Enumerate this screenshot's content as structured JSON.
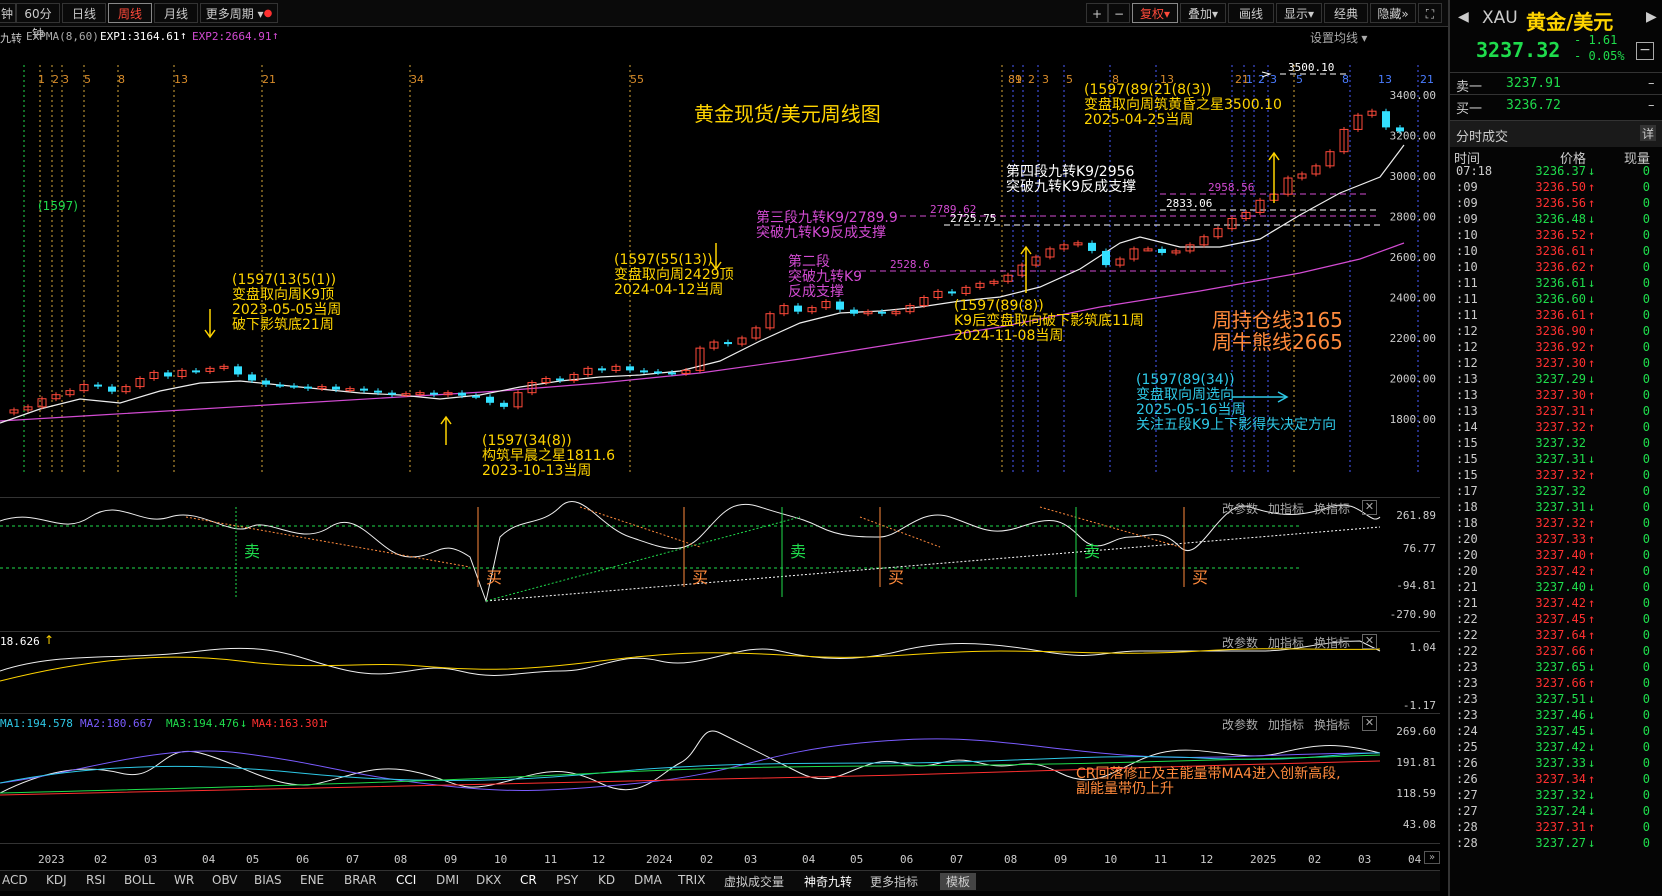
{
  "toolbar": {
    "left_tabs": [
      "钟",
      "60分钟",
      "日线",
      "周线",
      "月线",
      "更多周期"
    ],
    "active_tab": "周线",
    "right_icons": [
      "+",
      "−"
    ],
    "right_buttons": [
      "复权",
      "叠加",
      "画线",
      "显示",
      "经典",
      "隐藏"
    ],
    "collapse_glyph": "»"
  },
  "infobar": {
    "indicator": "九转",
    "expma": "EXPMA(8,60)",
    "exp1": "EXP1:3164.61",
    "exp2": "EXP2:2664.91",
    "settings": "设置均线"
  },
  "chart": {
    "title": "黄金现货/美元周线图",
    "price_labels": [
      "3400.00",
      "3200.00",
      "3000.00",
      "2800.00",
      "2600.00",
      "2400.00",
      "2200.00",
      "2000.00",
      "1800.00"
    ],
    "hline_values": [
      "3500.10",
      "2958.56",
      "2833.06",
      "2789.62",
      "2725.75",
      "2528.6"
    ],
    "fib_labels_orange": [
      "1",
      "2",
      "3",
      "5",
      "8",
      "13",
      "21",
      "34",
      "55",
      "89",
      "1",
      "2",
      "3",
      "5",
      "8",
      "13",
      "21"
    ],
    "fib_labels_blue": [
      "1",
      "2",
      "3",
      "5",
      "8",
      "13",
      "21"
    ],
    "fib_green": "(1597)",
    "annotations": [
      {
        "text": "(1597(13(5(1))\n变盘取向周K9顶\n2023-05-05当周\n破下影筑底21周",
        "color": "#ffd400"
      },
      {
        "text": "(1597(34(8))\n构筑早晨之星1811.6\n2023-10-13当周",
        "color": "#ffd400"
      },
      {
        "text": "(1597(55(13))\n变盘取向周2429顶\n2024-04-12当周",
        "color": "#ffd400"
      },
      {
        "text": "第三段九转K9/2789.9\n突破九转K9反成支撑",
        "color": "#d24bd2"
      },
      {
        "text": "第二段\n突破九转K9\n反成支撑",
        "color": "#d24bd2"
      },
      {
        "text": "第四段九转K9/2956\n突破九转K9反成支撑",
        "color": "#ffffff"
      },
      {
        "text": "(1597(89(21(8(3))\n变盘取向周筑黄昏之星3500.10\n2025-04-25当周",
        "color": "#ffd400"
      },
      {
        "text": "(1597(89(8))\nK9后变盘取向破下影筑底11周\n2024-11-08当周",
        "color": "#ffd400"
      },
      {
        "text": "(1597(89(34))\n变盘取向周选向\n2025-05-16当周\n关注五段K9上下影得失决定方向",
        "color": "#2ec8e6"
      },
      {
        "text": "周持仓线3165\n周牛熊线2665",
        "color": "#ff8a3c"
      }
    ]
  },
  "panels": {
    "actions": [
      "改参数",
      "加指标",
      "换指标"
    ],
    "p1": {
      "labels": [
        "261.89",
        "76.77",
        "-94.81",
        "-270.90"
      ],
      "marks": [
        "卖",
        "买",
        "买",
        "卖",
        "买",
        "卖",
        "买"
      ]
    },
    "p2": {
      "value": "18.626",
      "labels": [
        "1.04",
        "-1.17"
      ]
    },
    "p3": {
      "ma1": "MA1:194.578",
      "ma2": "MA2:180.667",
      "ma3": "MA3:194.476",
      "ma4": "MA4:163.301",
      "labels": [
        "269.60",
        "191.81",
        "118.59",
        "43.08"
      ],
      "note": "CR回落修正及主能量带MA4进入创新高段,\n副能量带仍上升"
    }
  },
  "xaxis": [
    "2023",
    "02",
    "03",
    "04",
    "05",
    "06",
    "07",
    "08",
    "09",
    "10",
    "11",
    "12",
    "2024",
    "02",
    "03",
    "04",
    "05",
    "06",
    "07",
    "08",
    "09",
    "10",
    "11",
    "12",
    "2025",
    "02",
    "03",
    "04",
    "05"
  ],
  "bottom_tabs": [
    "ACD",
    "KDJ",
    "RSI",
    "BOLL",
    "WR",
    "OBV",
    "BIAS",
    "ENE",
    "BRAR",
    "CCI",
    "DMI",
    "DKX",
    "CR",
    "PSY",
    "KD",
    "DMA",
    "TRIX",
    "虚拟成交量",
    "神奇九转",
    "更多指标",
    "模板"
  ],
  "sidebar": {
    "code": "XAU",
    "name": "黄金/美元",
    "price": "3237.32",
    "change": "- 1.61",
    "pct": "- 0.05%",
    "sell_label": "卖一",
    "sell_price": "3237.91",
    "sell_dash": "–",
    "buy_label": "买一",
    "buy_price": "3236.72",
    "buy_dash": "–",
    "section_title": "分时成交",
    "detail": "详",
    "col_time": "时间",
    "col_price": "价格",
    "col_vol": "现量",
    "ticks": [
      {
        "t": "07:18",
        "p": "3236.37",
        "d": "down"
      },
      {
        "t": ":09",
        "p": "3236.50",
        "d": "up"
      },
      {
        "t": ":09",
        "p": "3236.56",
        "d": "up"
      },
      {
        "t": ":09",
        "p": "3236.48",
        "d": "down"
      },
      {
        "t": ":10",
        "p": "3236.52",
        "d": "up"
      },
      {
        "t": ":10",
        "p": "3236.61",
        "d": "up"
      },
      {
        "t": ":10",
        "p": "3236.62",
        "d": "up"
      },
      {
        "t": ":11",
        "p": "3236.61",
        "d": "down"
      },
      {
        "t": ":11",
        "p": "3236.60",
        "d": "down"
      },
      {
        "t": ":11",
        "p": "3236.61",
        "d": "up"
      },
      {
        "t": ":12",
        "p": "3236.90",
        "d": "up"
      },
      {
        "t": ":12",
        "p": "3236.92",
        "d": "up"
      },
      {
        "t": ":12",
        "p": "3237.30",
        "d": "up"
      },
      {
        "t": ":13",
        "p": "3237.29",
        "d": "down"
      },
      {
        "t": ":13",
        "p": "3237.30",
        "d": "up"
      },
      {
        "t": ":13",
        "p": "3237.31",
        "d": "up"
      },
      {
        "t": ":14",
        "p": "3237.32",
        "d": "up"
      },
      {
        "t": ":15",
        "p": "3237.32",
        "d": ""
      },
      {
        "t": ":15",
        "p": "3237.31",
        "d": "down"
      },
      {
        "t": ":15",
        "p": "3237.32",
        "d": "up"
      },
      {
        "t": ":17",
        "p": "3237.32",
        "d": ""
      },
      {
        "t": ":18",
        "p": "3237.31",
        "d": "down"
      },
      {
        "t": ":18",
        "p": "3237.32",
        "d": "up"
      },
      {
        "t": ":20",
        "p": "3237.33",
        "d": "up"
      },
      {
        "t": ":20",
        "p": "3237.40",
        "d": "up"
      },
      {
        "t": ":20",
        "p": "3237.42",
        "d": "up"
      },
      {
        "t": ":21",
        "p": "3237.40",
        "d": "down"
      },
      {
        "t": ":21",
        "p": "3237.42",
        "d": "up"
      },
      {
        "t": ":22",
        "p": "3237.45",
        "d": "up"
      },
      {
        "t": ":22",
        "p": "3237.64",
        "d": "up"
      },
      {
        "t": ":22",
        "p": "3237.66",
        "d": "up"
      },
      {
        "t": ":23",
        "p": "3237.65",
        "d": "down"
      },
      {
        "t": ":23",
        "p": "3237.66",
        "d": "up"
      },
      {
        "t": ":23",
        "p": "3237.51",
        "d": "down"
      },
      {
        "t": ":23",
        "p": "3237.46",
        "d": "down"
      },
      {
        "t": ":24",
        "p": "3237.45",
        "d": "down"
      },
      {
        "t": ":25",
        "p": "3237.42",
        "d": "down"
      },
      {
        "t": ":26",
        "p": "3237.33",
        "d": "down"
      },
      {
        "t": ":26",
        "p": "3237.34",
        "d": "up"
      },
      {
        "t": ":27",
        "p": "3237.32",
        "d": "down"
      },
      {
        "t": ":27",
        "p": "3237.24",
        "d": "down"
      },
      {
        "t": ":28",
        "p": "3237.31",
        "d": "up"
      },
      {
        "t": ":28",
        "p": "3237.27",
        "d": "down"
      }
    ],
    "tick_vol": "0"
  }
}
